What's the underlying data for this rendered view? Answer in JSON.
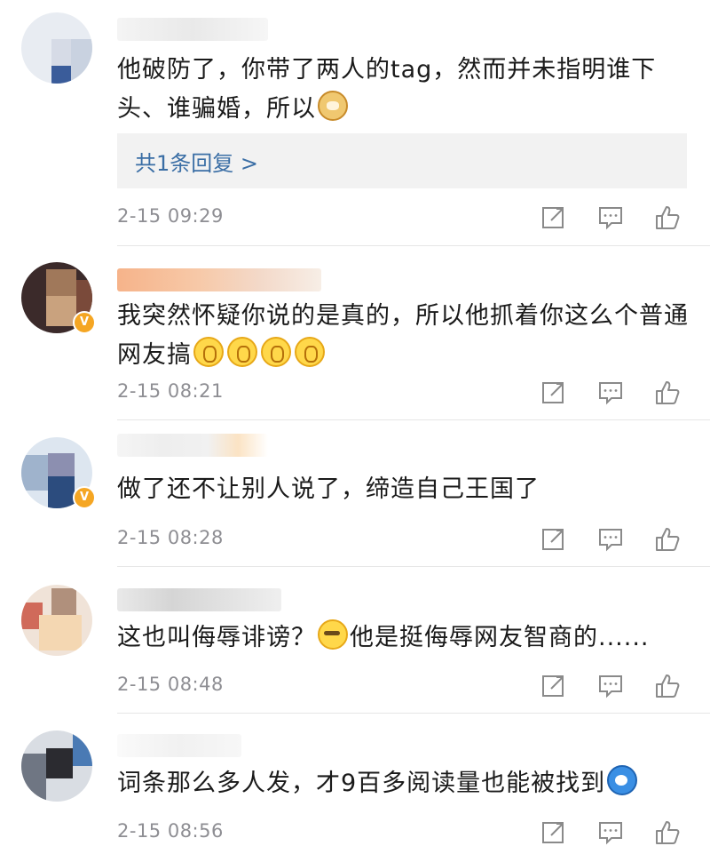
{
  "comments": [
    {
      "text": "他破防了，你带了两人的tag，然而并未指明谁下头、谁骗婚，所以",
      "emoji": "doge-emoji",
      "reply_label": "共1条回复 >",
      "time": "2-15 09:29",
      "verified": false
    },
    {
      "text": "我突然怀疑你说的是真的，所以他抓着你这么个普通网友搞",
      "emoji": "clap-emoji",
      "time": "2-15 08:21",
      "verified": true,
      "verified_badge": "V"
    },
    {
      "text": "做了还不让别人说了，缔造自己王国了",
      "time": "2-15 08:28",
      "verified": true,
      "verified_badge": "V"
    },
    {
      "text_before": "这也叫侮辱诽谤？",
      "text_after": "他是挺侮辱网友智商的......",
      "emoji": "smirk-emoji",
      "time": "2-15 08:48",
      "verified": false
    },
    {
      "text": "词条那么多人发，才9百多阅读量也能被找到",
      "emoji": "blue-face-emoji",
      "time": "2-15 08:56",
      "verified": false
    }
  ],
  "action_icons": [
    "share-icon",
    "comment-icon",
    "like-icon"
  ],
  "colors": {
    "text": "#1a1a1a",
    "time": "#8e8e93",
    "link": "#3a6ea5",
    "reply_bg": "#f2f2f2",
    "verified": "#f5a623"
  }
}
